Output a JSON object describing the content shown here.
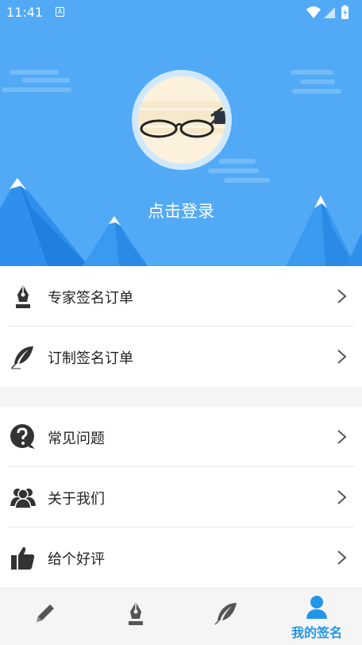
{
  "status_bar": {
    "time": "11:41",
    "notification_glyph": "A"
  },
  "header": {
    "login_text": "点击登录",
    "accent_color": "#52aaf6"
  },
  "menu_group_1": [
    {
      "label": "专家签名订单",
      "icon": "fountain-pen-icon"
    },
    {
      "label": "订制签名订单",
      "icon": "feather-icon"
    }
  ],
  "menu_group_2": [
    {
      "label": "常见问题",
      "icon": "question-bubble-icon"
    },
    {
      "label": "关于我们",
      "icon": "people-icon"
    },
    {
      "label": "给个好评",
      "icon": "thumbs-up-icon"
    }
  ],
  "bottom_nav": {
    "items": [
      {
        "icon": "pencil-icon",
        "label": ""
      },
      {
        "icon": "fountain-pen-icon",
        "label": ""
      },
      {
        "icon": "feather-icon",
        "label": ""
      },
      {
        "icon": "person-icon",
        "label": "我的签名",
        "active": true
      }
    ],
    "active_color": "#2196e8"
  }
}
